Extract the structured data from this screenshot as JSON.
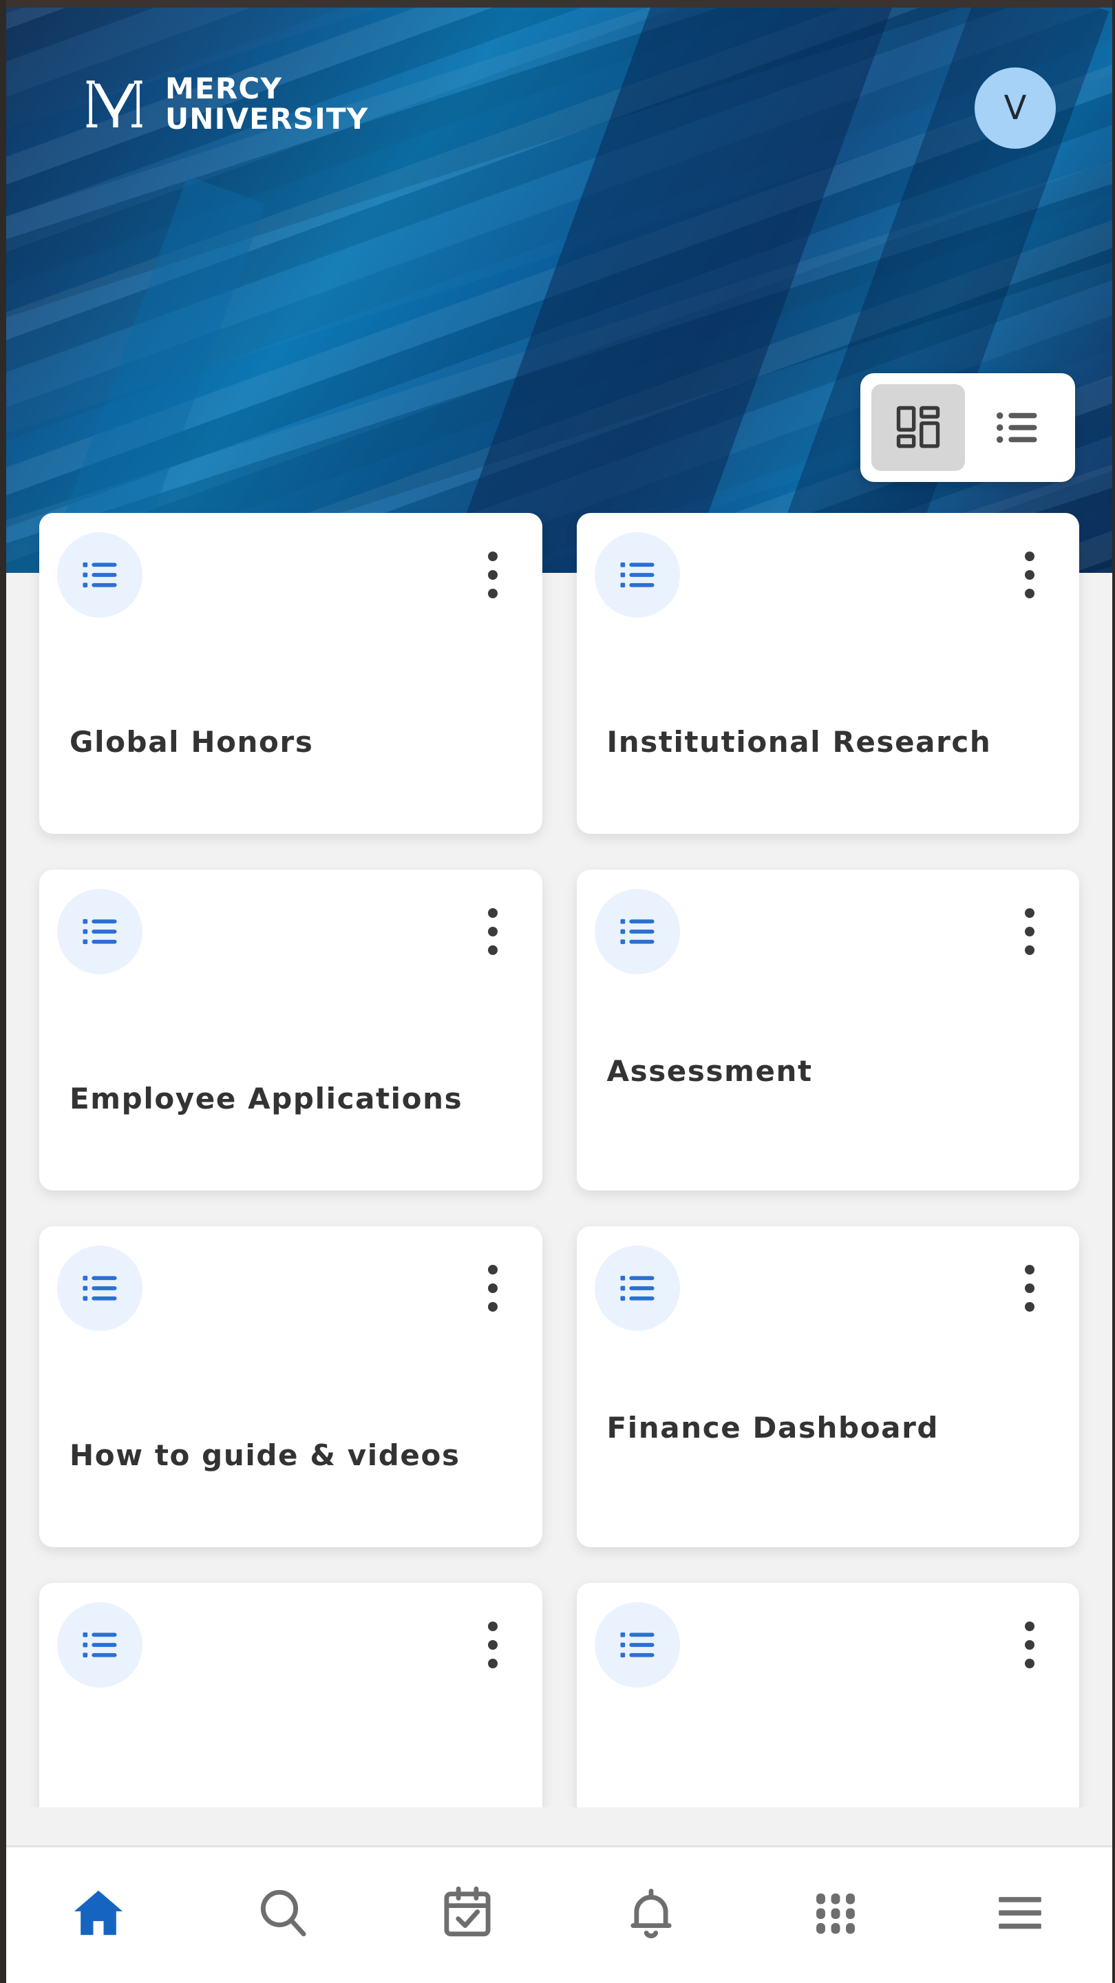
{
  "app": {
    "brand_line1": "MERCY",
    "brand_line2": "UNIVERSITY",
    "logo_icon": "mercy-m-monogram",
    "accent_blue": "#1565c0",
    "banner_blue_dark": "#0d3360",
    "banner_blue_light": "#0c78b4",
    "card_icon_bg": "#eaf2fd",
    "avatar_bg": "#a6d2f7"
  },
  "header": {
    "avatar_initial": "V",
    "avatar_name": "user-avatar"
  },
  "view_toggle": {
    "grid_label": "grid-view",
    "grid_icon": "dashboard-grid-icon",
    "list_label": "list-view",
    "list_icon": "list-view-icon",
    "selected": "grid-view"
  },
  "cards": [
    {
      "title": "Global Honors",
      "icon": "list-icon",
      "menu_icon": "kebab-menu-icon"
    },
    {
      "title": "Institutional Research",
      "icon": "list-icon",
      "menu_icon": "kebab-menu-icon"
    },
    {
      "title": "Employee Applications",
      "icon": "list-icon",
      "menu_icon": "kebab-menu-icon"
    },
    {
      "title": "Assessment",
      "icon": "list-icon",
      "menu_icon": "kebab-menu-icon"
    },
    {
      "title": "How to guide & videos",
      "icon": "list-icon",
      "menu_icon": "kebab-menu-icon"
    },
    {
      "title": "Finance Dashboard",
      "icon": "list-icon",
      "menu_icon": "kebab-menu-icon"
    },
    {
      "title": "",
      "icon": "list-icon",
      "menu_icon": "kebab-menu-icon"
    },
    {
      "title": "",
      "icon": "list-icon",
      "menu_icon": "kebab-menu-icon"
    }
  ],
  "bottom_nav": {
    "active": "home",
    "items": [
      {
        "id": "home",
        "icon": "home-icon",
        "label": "Home"
      },
      {
        "id": "search",
        "icon": "search-icon",
        "label": "Search"
      },
      {
        "id": "tasks",
        "icon": "calendar-check-icon",
        "label": "Tasks"
      },
      {
        "id": "notifications",
        "icon": "bell-icon",
        "label": "Notifications"
      },
      {
        "id": "apps",
        "icon": "grid-apps-icon",
        "label": "Apps"
      },
      {
        "id": "menu",
        "icon": "hamburger-menu-icon",
        "label": "Menu"
      }
    ]
  }
}
